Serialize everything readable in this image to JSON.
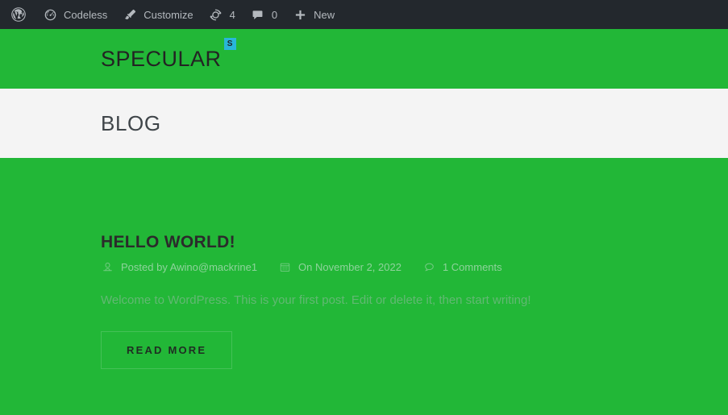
{
  "admin_bar": {
    "items": [
      {
        "id": "wp-logo",
        "icon": "wordpress-logo-icon",
        "label": "",
        "count": ""
      },
      {
        "id": "site-name",
        "icon": "dashboard-speedometer-icon",
        "label": "Codeless",
        "count": ""
      },
      {
        "id": "customize",
        "icon": "paintbrush-icon",
        "label": "Customize",
        "count": ""
      },
      {
        "id": "updates",
        "icon": "update-arrows-icon",
        "label": "",
        "count": "4"
      },
      {
        "id": "comments",
        "icon": "comment-bubble-icon",
        "label": "",
        "count": "0"
      },
      {
        "id": "new-content",
        "icon": "plus-icon",
        "label": "New",
        "count": ""
      }
    ]
  },
  "site_header": {
    "brand_name": "SPECULAR",
    "brand_badge": "S"
  },
  "page": {
    "title": "BLOG"
  },
  "post": {
    "title": "HELLO WORLD!",
    "meta": {
      "author_icon": "user-icon",
      "author": "Posted by Awino@mackrine1",
      "date_icon": "calendar-icon",
      "date": "On November 2, 2022",
      "comments_icon": "comment-bubble-icon",
      "comments": "1 Comments"
    },
    "excerpt": "Welcome to WordPress. This is your first post. Edit or delete it, then start writing!",
    "read_more_label": "READ MORE"
  },
  "colors": {
    "brand_green": "#22b737",
    "admin_bar": "#23282d",
    "title_band": "#f4f4f4",
    "badge_cyan": "#29b6d8",
    "muted_text": "#8ed39b"
  }
}
